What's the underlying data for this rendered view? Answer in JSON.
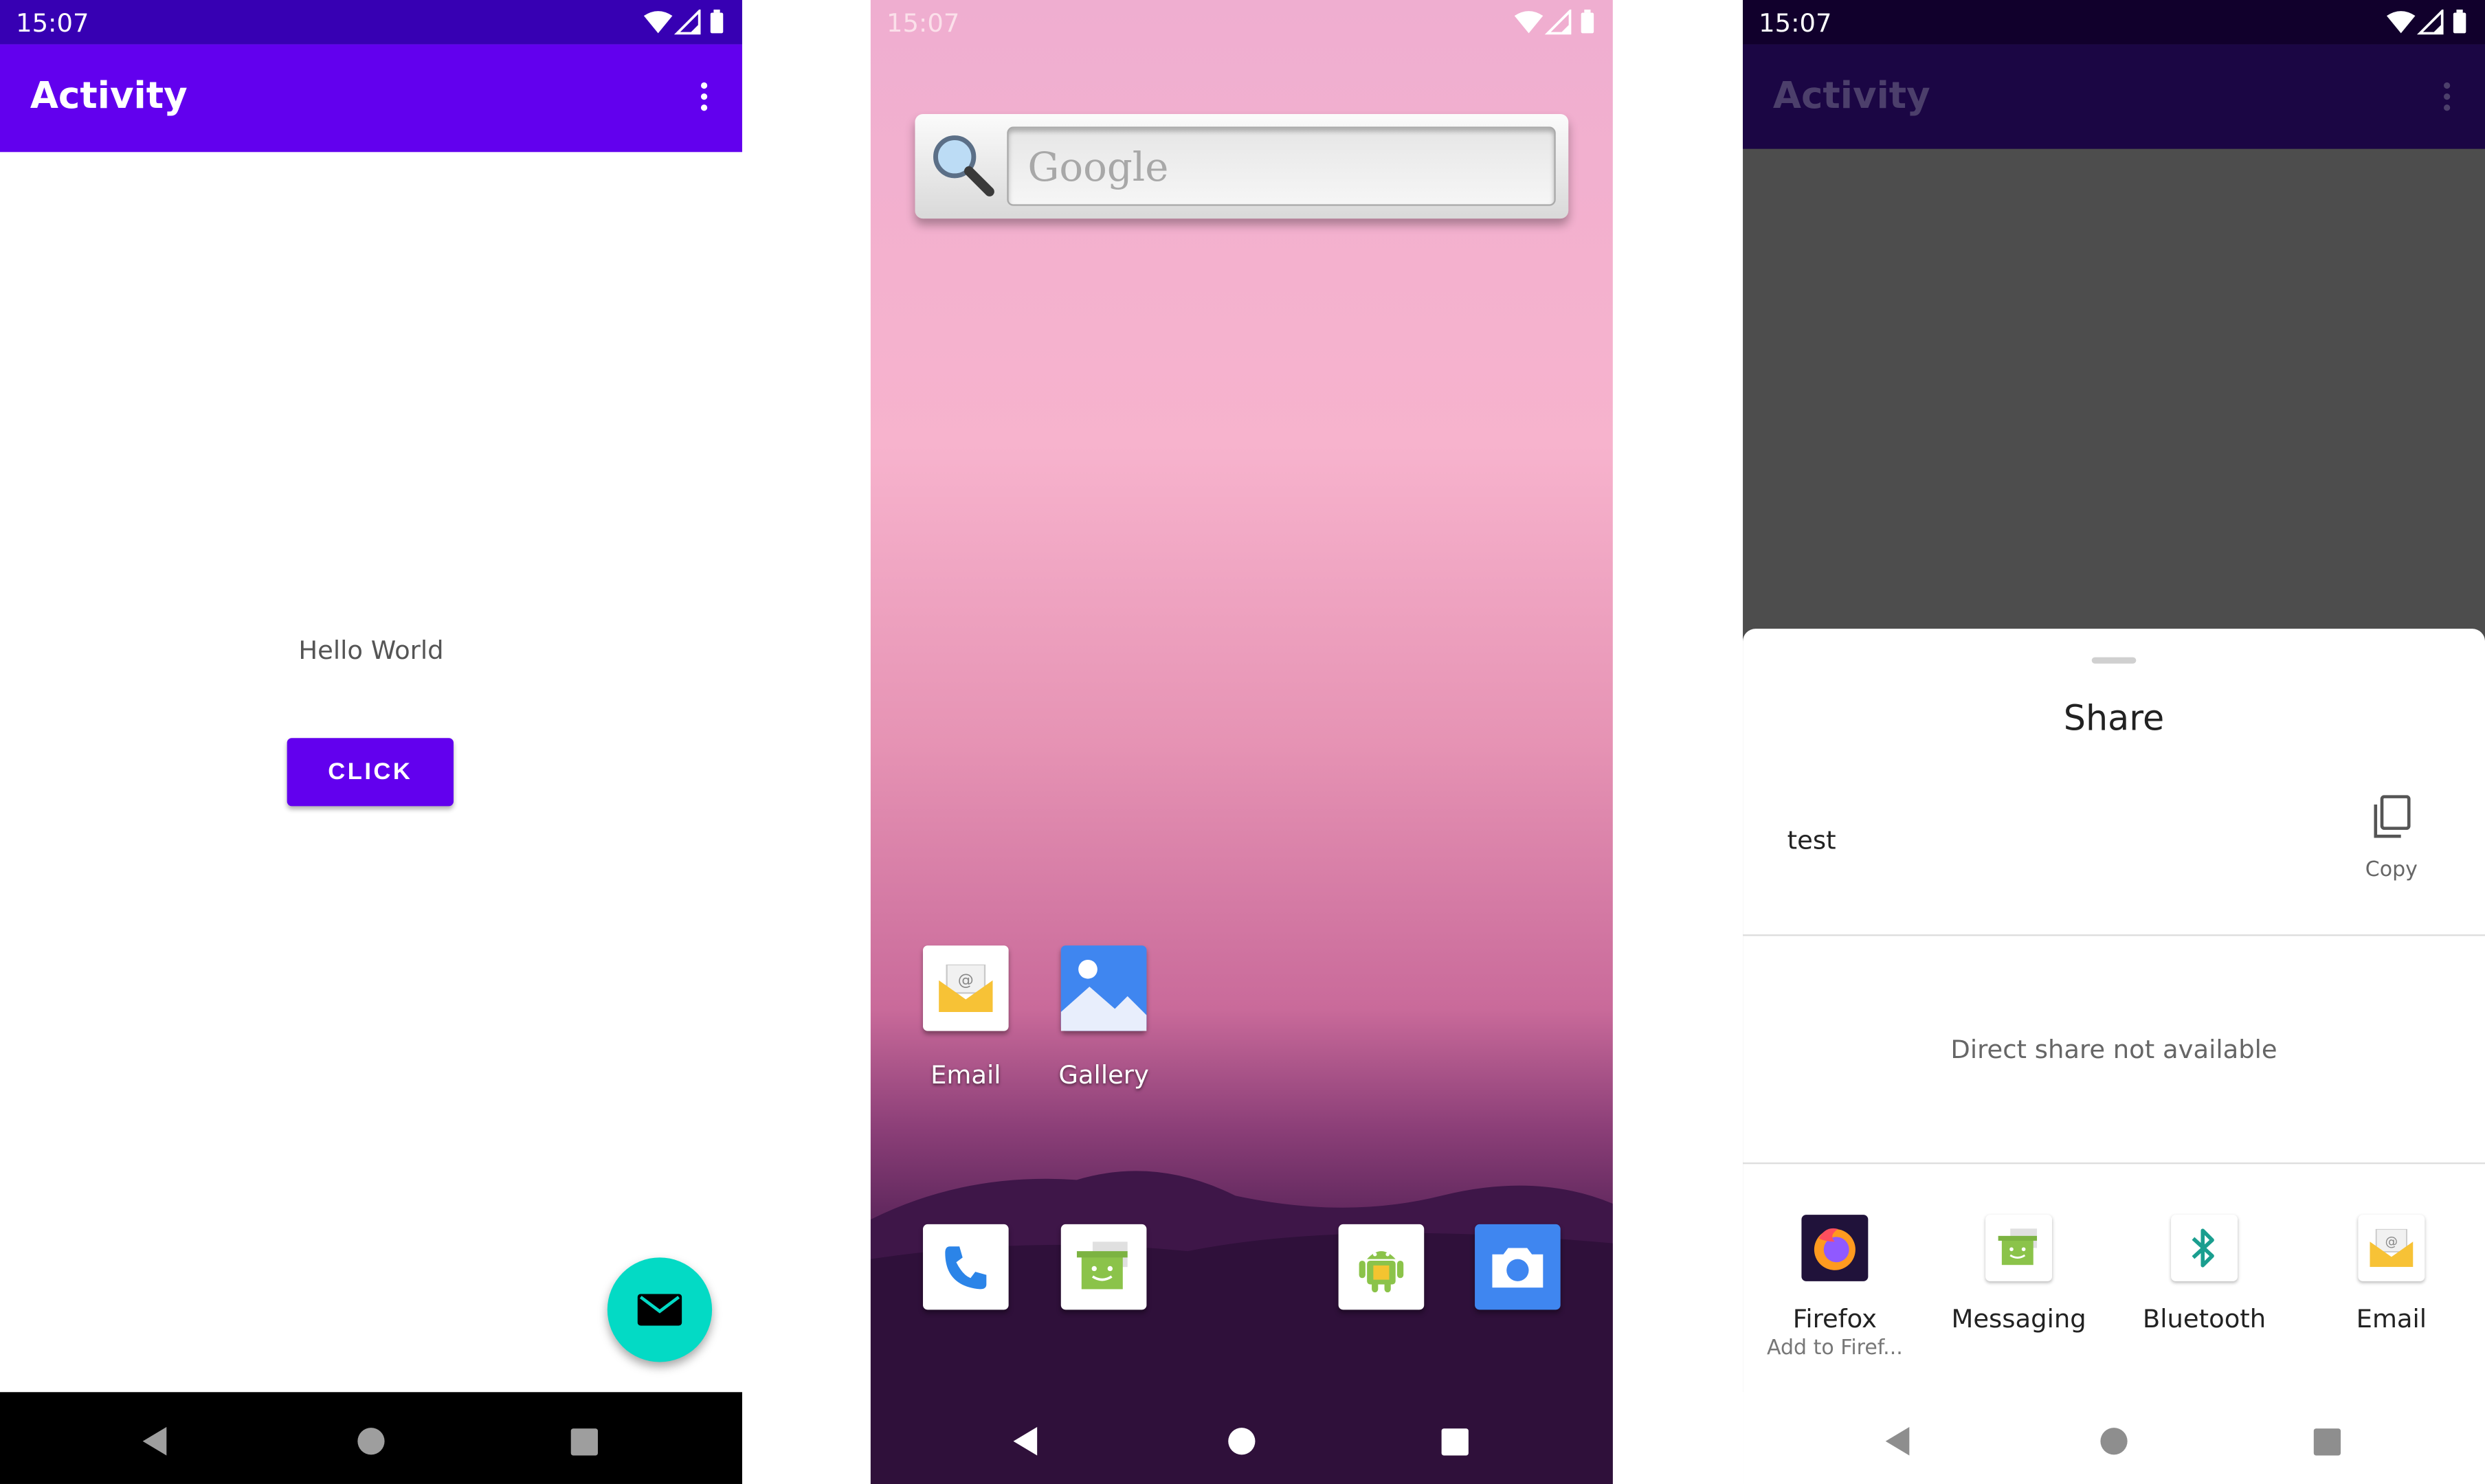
{
  "left_phone": {
    "status_time": "15:07",
    "app_title": "Activity",
    "hello_text": "Hello World",
    "click_label": "CLICK",
    "colors": {
      "primary": "#6200ee",
      "primary_dark": "#3700b3",
      "accent": "#03dac5"
    }
  },
  "home_screen": {
    "status_time": "15:07",
    "search_hint": "Google",
    "apps": [
      {
        "label": "Email",
        "icon": "email-icon"
      },
      {
        "label": "Gallery",
        "icon": "gallery-icon"
      }
    ],
    "dock": [
      "phone-icon",
      "messaging-icon",
      "android-store-icon",
      "camera-icon"
    ]
  },
  "share_phone": {
    "status_time": "15:07",
    "app_title": "Activity",
    "share_title": "Share",
    "shared_text": "test",
    "copy_label": "Copy",
    "direct_share_message": "Direct share not available",
    "targets": [
      {
        "label": "Firefox",
        "sublabel": "Add to Firef...",
        "icon": "firefox-icon"
      },
      {
        "label": "Messaging",
        "sublabel": "",
        "icon": "messaging-icon"
      },
      {
        "label": "Bluetooth",
        "sublabel": "",
        "icon": "bluetooth-icon"
      },
      {
        "label": "Email",
        "sublabel": "",
        "icon": "email-icon"
      }
    ]
  }
}
